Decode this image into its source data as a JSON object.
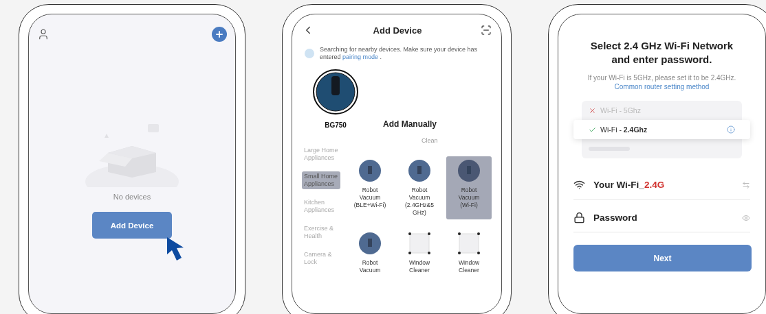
{
  "home_screen": {
    "empty_text": "No devices",
    "add_button": "Add Device"
  },
  "add_device_screen": {
    "title": "Add Device",
    "hint": {
      "text": "Searching for nearby devices. Make sure your device has entered",
      "link": "pairing mode",
      "end": "."
    },
    "found_device": {
      "name": "BG750"
    },
    "section_title": "Add Manually",
    "category_heading": "Clean",
    "categories": [
      {
        "label": "Large Home Appliances",
        "selected": false
      },
      {
        "label": "Small Home Appliances",
        "selected": true
      },
      {
        "label": "Kitchen Appliances",
        "selected": false
      },
      {
        "label": "Exercise & Health",
        "selected": false
      },
      {
        "label": "Camera & Lock",
        "selected": false
      }
    ],
    "devices": [
      {
        "kind": "vacuum",
        "label": "Robot Vacuum (BLE+Wi-Fi)",
        "selected": false
      },
      {
        "kind": "vacuum",
        "label": "Robot Vacuum (2.4GHz&5 GHz)",
        "selected": false
      },
      {
        "kind": "vacuum",
        "label": "Robot Vacuum (Wi-Fi)",
        "selected": true
      },
      {
        "kind": "vacuum",
        "label": "Robot Vacuum",
        "selected": false
      },
      {
        "kind": "window-cleaner",
        "label": "Window Cleaner",
        "selected": false
      },
      {
        "kind": "window-cleaner",
        "label": "Window Cleaner",
        "selected": false
      }
    ]
  },
  "wifi_screen": {
    "title": "Select 2.4 GHz Wi-Fi Network and enter password.",
    "hint": {
      "text": "If your Wi-Fi is 5GHz, please set it to be 2.4GHz.",
      "link": "Common router setting method"
    },
    "networks": [
      {
        "kind": "unsupported",
        "label": "Wi-Fi - 5Ghz",
        "selected": false
      },
      {
        "kind": "supported",
        "label": "Wi-Fi - **2.4Ghz**",
        "selected": true
      },
      {
        "kind": "blurred",
        "selected": false
      }
    ],
    "ssid": "Your Wi-Fi_**2.4G**",
    "password_placeholder": "Password",
    "next_button": "Next"
  }
}
